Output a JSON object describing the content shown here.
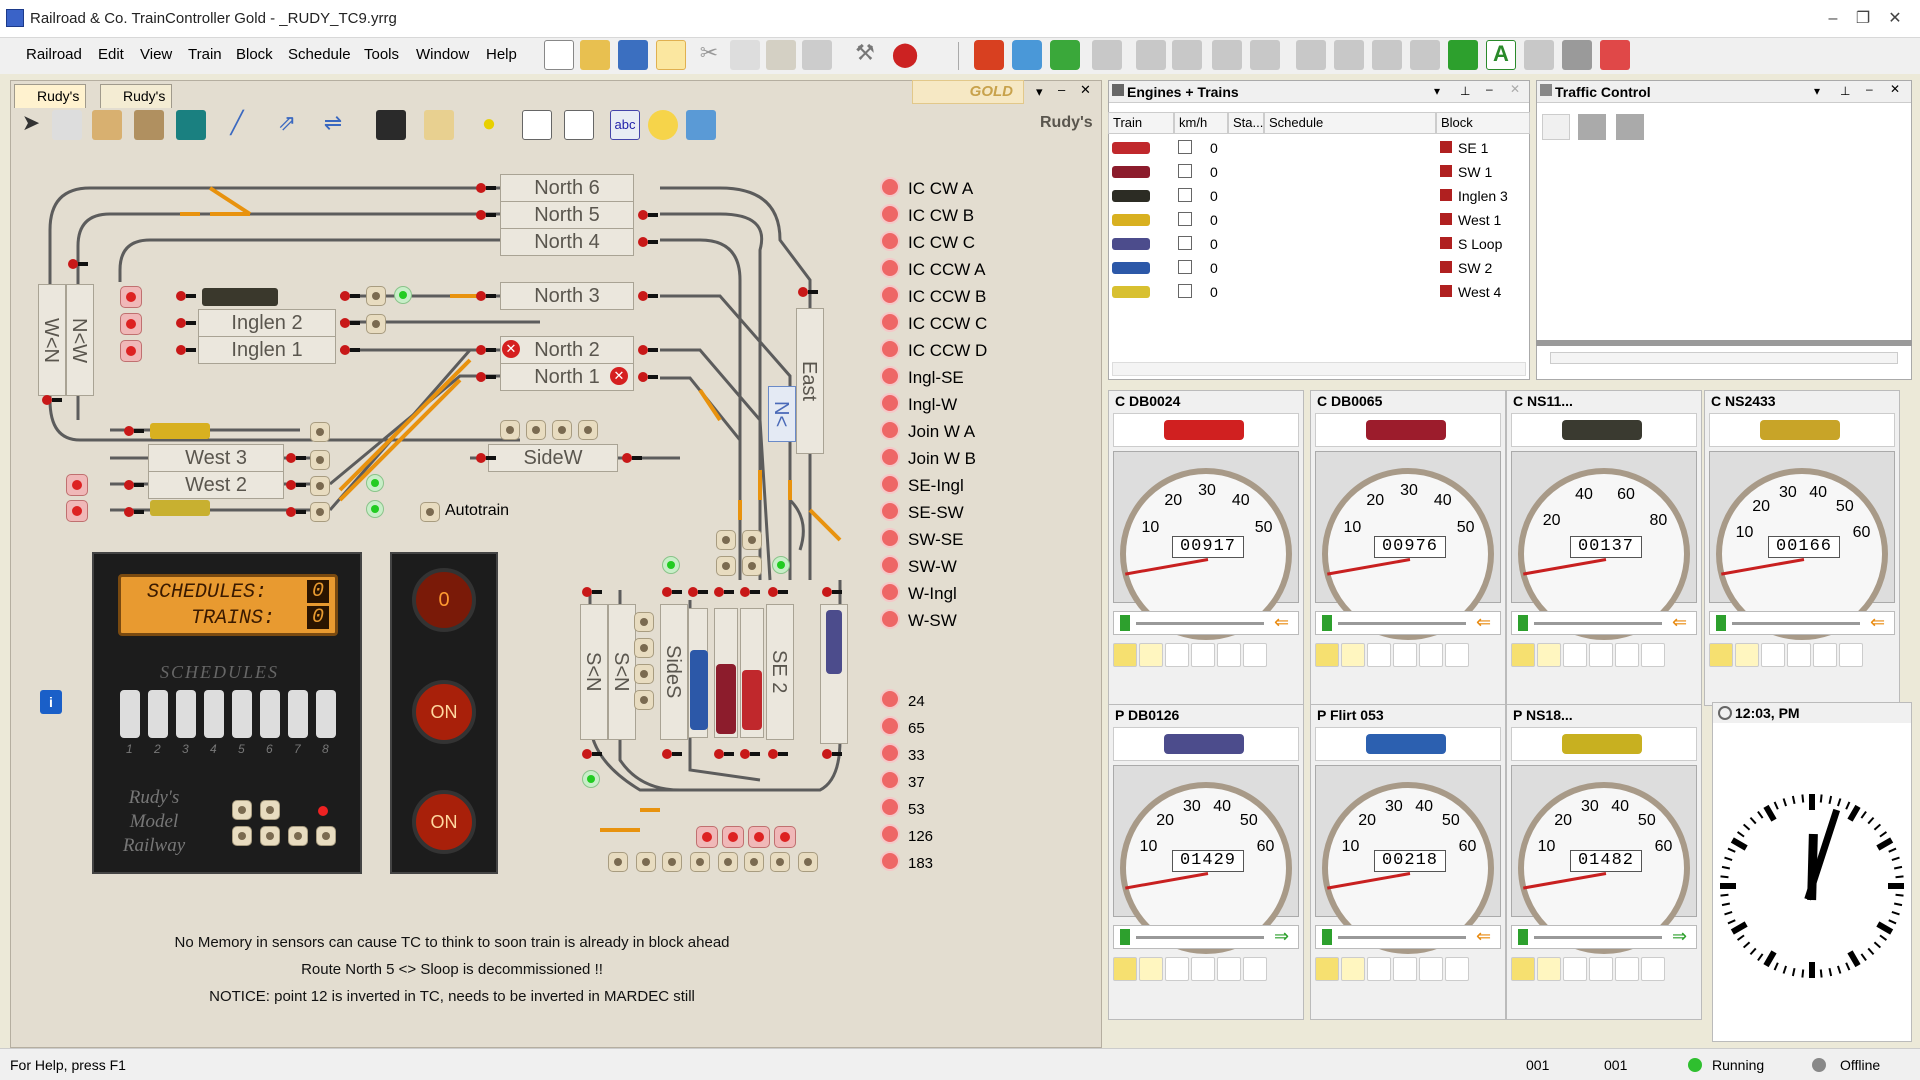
{
  "window": {
    "title": "Railroad & Co. TrainController Gold - _RUDY_TC9.yrrg"
  },
  "menu": [
    "Railroad",
    "Edit",
    "View",
    "Train",
    "Block",
    "Schedule",
    "Tools",
    "Window",
    "Help"
  ],
  "tabs": [
    "Rudy's",
    "Rudy's"
  ],
  "edition_badge": "GOLD",
  "layout_title": "Rudy's",
  "blocks": {
    "north6": "North 6",
    "north5": "North 5",
    "north4": "North 4",
    "north3": "North 3",
    "inglen2": "Inglen 2",
    "inglen1": "Inglen 1",
    "north2": "North 2",
    "north1": "North 1",
    "west3": "West 3",
    "west2": "West 2",
    "sidew": "SideW",
    "wn1": "W<N",
    "wn2": "N<W",
    "east": "East",
    "nv": "N<",
    "sn1": "S<N",
    "sn2": "S<N",
    "sides": "SideS",
    "se2": "SE 2"
  },
  "autotrain_label": "Autotrain",
  "routes": [
    "IC CW A",
    "IC CW B",
    "IC CW C",
    "IC CCW A",
    "IC CCW B",
    "IC CCW C",
    "IC CCW D",
    "Ingl-SE",
    "Ingl-W",
    "Join W A",
    "Join W B",
    "SE-Ingl",
    "SE-SW",
    "SW-SE",
    "SW-W",
    "W-Ingl",
    "W-SW"
  ],
  "numbered_routes": [
    "24",
    "65",
    "33",
    "37",
    "53",
    "126",
    "183"
  ],
  "display": {
    "schedules_label": "SCHEDULES:",
    "schedules_value": "0",
    "trains_label": "TRAINS:",
    "trains_value": "0",
    "schedules_title": "SCHEDULES",
    "switch_numbers": [
      "1",
      "2",
      "3",
      "4",
      "5",
      "6",
      "7",
      "8"
    ],
    "brand": [
      "Rudy's",
      "Model",
      "Railway"
    ]
  },
  "lamps": [
    "0",
    "ON",
    "ON"
  ],
  "notes": [
    "No Memory in sensors can cause TC to think to soon train is already in  block ahead",
    "Route North 5 <> Sloop is decommissioned !!",
    "NOTICE: point 12 is inverted in TC, needs to be inverted in MARDEC still"
  ],
  "engines_panel": {
    "title": "Engines + Trains",
    "columns": [
      "Train",
      "km/h",
      "Sta...",
      "Schedule",
      "Block"
    ],
    "rows": [
      {
        "speed": "0",
        "block": "SE 1",
        "color": "#c0282c"
      },
      {
        "speed": "0",
        "block": "SW 1",
        "color": "#8c1c2c"
      },
      {
        "speed": "0",
        "block": "Inglen 3",
        "color": "#2c2c24"
      },
      {
        "speed": "0",
        "block": "West 1",
        "color": "#d8b020"
      },
      {
        "speed": "0",
        "block": "S Loop",
        "color": "#4c4c8c"
      },
      {
        "speed": "0",
        "block": "SW 2",
        "color": "#2c58a8"
      },
      {
        "speed": "0",
        "block": "West 4",
        "color": "#d8c030"
      }
    ]
  },
  "traffic_panel": {
    "title": "Traffic Control"
  },
  "controllers": [
    {
      "name": "C DB0024",
      "odo": "00917",
      "ticks": [
        "10",
        "20",
        "30",
        "40",
        "50"
      ],
      "color": "#d02020"
    },
    {
      "name": "C DB0065",
      "odo": "00976",
      "ticks": [
        "10",
        "20",
        "30",
        "40",
        "50"
      ],
      "color": "#9c1c2c"
    },
    {
      "name": "C NS11...",
      "odo": "00137",
      "ticks": [
        "20",
        "40",
        "60",
        "80"
      ],
      "color": "#3a3a30"
    },
    {
      "name": "C NS2433",
      "odo": "00166",
      "ticks": [
        "10",
        "20",
        "30",
        "40",
        "50",
        "60"
      ],
      "color": "#c8a428"
    },
    {
      "name": "P DB0126",
      "odo": "01429",
      "ticks": [
        "10",
        "20",
        "30",
        "40",
        "50",
        "60"
      ],
      "color": "#4c4c8c"
    },
    {
      "name": "P Flirt 053",
      "odo": "00218",
      "ticks": [
        "10",
        "20",
        "30",
        "40",
        "50",
        "60"
      ],
      "color": "#2c60b0"
    },
    {
      "name": "P NS18...",
      "odo": "01482",
      "ticks": [
        "10",
        "20",
        "30",
        "40",
        "50",
        "60"
      ],
      "color": "#c8b020"
    }
  ],
  "clock": {
    "title": "12:03, PM",
    "hours": 12,
    "minutes": 3
  },
  "status": {
    "help": "For Help, press F1",
    "field1": "001",
    "field2": "001",
    "running": "Running",
    "offline": "Offline"
  }
}
